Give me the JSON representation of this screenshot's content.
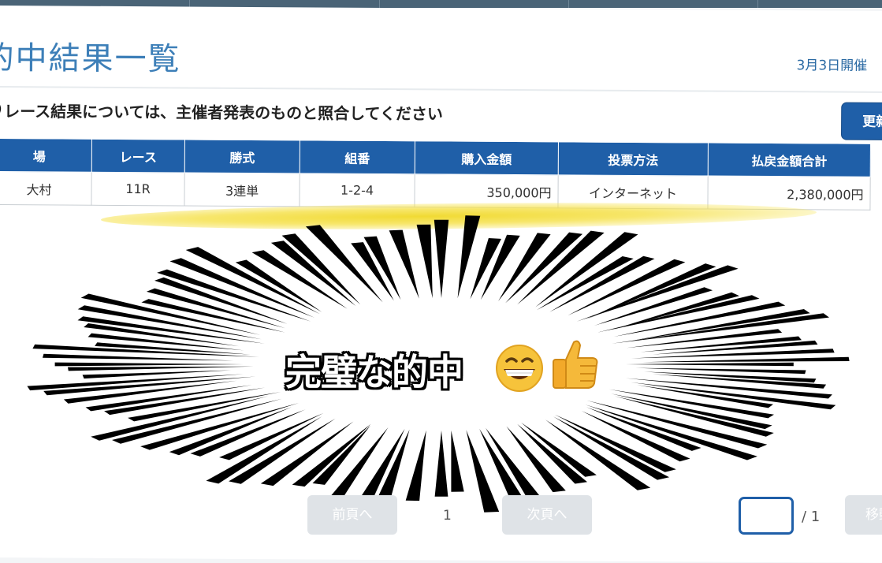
{
  "page": {
    "title": "的中結果一覧",
    "date_label": "3月3日開催",
    "notice_icon": "!",
    "notice": "レース結果については、主催者発表のものと照合してください",
    "update_button": "更新"
  },
  "table": {
    "headers": [
      "場",
      "レース",
      "勝式",
      "組番",
      "購入金額",
      "投票方法",
      "払戻金額合計"
    ],
    "rows": [
      [
        "大村",
        "11R",
        "3連単",
        "1-2-4",
        "350,000円",
        "インターネット",
        "2,380,000円"
      ]
    ]
  },
  "overlay": {
    "caption": "完璧な的中",
    "emoji": [
      "grinning-face-icon",
      "thumbs-up-icon"
    ],
    "highlight_color": "#f0d828"
  },
  "pagination": {
    "prev_label": "前頁へ",
    "current_page": "1",
    "next_label": "次頁へ",
    "total": "/ 1",
    "move_label": "移動"
  },
  "colors": {
    "header_bg": "#1f5fa8",
    "title": "#3d7fb8",
    "topbar": "#4a6477"
  }
}
